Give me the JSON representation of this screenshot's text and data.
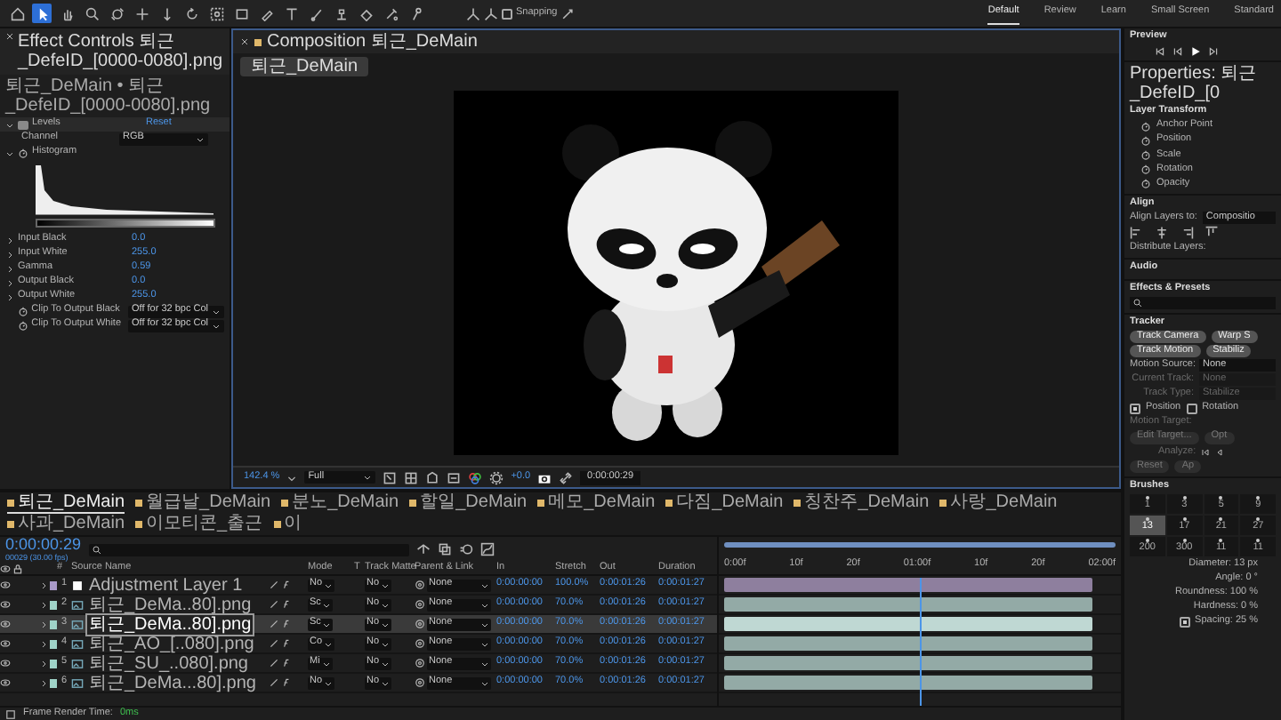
{
  "toolbar": {
    "tools": [
      {
        "kind": "home",
        "selected": false
      },
      {
        "kind": "selection",
        "selected": true
      },
      {
        "kind": "hand",
        "selected": false
      },
      {
        "kind": "zoom",
        "selected": false
      },
      {
        "kind": "orbit",
        "selected": false
      },
      {
        "kind": "pan",
        "selected": false
      },
      {
        "kind": "dolly",
        "selected": false
      },
      {
        "kind": "rotate",
        "selected": false
      },
      {
        "kind": "anchor",
        "selected": false
      },
      {
        "kind": "rectangle",
        "selected": false
      },
      {
        "kind": "pen",
        "selected": false
      },
      {
        "kind": "type",
        "selected": false
      },
      {
        "kind": "brush",
        "selected": false
      },
      {
        "kind": "stamp",
        "selected": false
      },
      {
        "kind": "eraser",
        "selected": false
      },
      {
        "kind": "roto",
        "selected": false
      },
      {
        "kind": "puppet",
        "selected": false
      }
    ],
    "snapping": {
      "label": "Snapping",
      "checked": false
    },
    "workspaces": [
      {
        "label": "Default",
        "selected": true
      },
      {
        "label": "Review",
        "selected": false
      },
      {
        "label": "Learn",
        "selected": false
      },
      {
        "label": "Small Screen",
        "selected": false
      },
      {
        "label": "Standard",
        "selected": false
      }
    ]
  },
  "effect_controls": {
    "tab": "Effect Controls 퇴근_DefeID_[0000-0080].png",
    "breadcrumb": "퇴근_DeMain • 퇴근_DefeID_[0000-0080].png",
    "effect": "Levels",
    "reset": "Reset",
    "channel_label": "Channel",
    "channel": "RGB",
    "histogram_label": "Histogram",
    "properties": [
      {
        "kind": "value",
        "label": "Input Black",
        "value": "0.0"
      },
      {
        "kind": "value",
        "label": "Input White",
        "value": "255.0"
      },
      {
        "kind": "value",
        "label": "Gamma",
        "value": "0.59"
      },
      {
        "kind": "value",
        "label": "Output Black",
        "value": "0.0"
      },
      {
        "kind": "value",
        "label": "Output White",
        "value": "255.0"
      },
      {
        "kind": "dropdown",
        "label": "Clip To Output Black",
        "value": "Off for 32 bpc Col"
      },
      {
        "kind": "dropdown",
        "label": "Clip To Output White",
        "value": "Off for 32 bpc Col"
      }
    ]
  },
  "composition": {
    "tab": "Composition 퇴근_DeMain",
    "chip": "퇴근_DeMain",
    "zoom": "142.4 %",
    "resolution": "Full",
    "exposure": "+0.0",
    "timecode": "0:00:00:29"
  },
  "right_panel": {
    "preview": "Preview",
    "properties_title": "Properties: 퇴근_DefeID_[0",
    "layer_transform": "Layer Transform",
    "transform_items": [
      "Anchor Point",
      "Position",
      "Scale",
      "Rotation",
      "Opacity"
    ],
    "align": "Align",
    "align_to_label": "Align Layers to:",
    "align_to": "Compositio",
    "distribute_label": "Distribute Layers:",
    "audio": "Audio",
    "effects_presets": "Effects & Presets",
    "tracker": {
      "title": "Tracker",
      "buttons": [
        {
          "label": "Track Camera",
          "disabled": false
        },
        {
          "label": "Warp S",
          "disabled": false
        },
        {
          "label": "Track Motion",
          "disabled": false
        },
        {
          "label": "Stabiliz",
          "disabled": false
        }
      ],
      "fields": [
        {
          "label": "Motion Source:",
          "value": "None",
          "disabled": false
        },
        {
          "label": "Current Track:",
          "value": "None",
          "disabled": true
        },
        {
          "label": "Track Type:",
          "value": "Stabilize",
          "disabled": true
        }
      ],
      "options": [
        {
          "label": "Position",
          "checked": true
        },
        {
          "label": "Rotation",
          "checked": false
        }
      ],
      "motion_target_label": "Motion Target:",
      "target_buttons": [
        {
          "label": "Edit Target...",
          "disabled": true
        },
        {
          "label": "Opt",
          "disabled": true
        }
      ],
      "analyze_label": "Analyze:",
      "action_buttons": [
        {
          "label": "Reset",
          "disabled": true
        },
        {
          "label": "Ap",
          "disabled": true
        }
      ]
    },
    "brushes": {
      "title": "Brushes",
      "sizes": [
        {
          "label": "1",
          "selected": false
        },
        {
          "label": "3",
          "selected": false
        },
        {
          "label": "5",
          "selected": false
        },
        {
          "label": "9",
          "selected": false
        },
        {
          "label": "13",
          "selected": true
        },
        {
          "label": "17",
          "selected": false
        },
        {
          "label": "21",
          "selected": false
        },
        {
          "label": "27",
          "selected": false
        },
        {
          "label": "200",
          "selected": false
        },
        {
          "label": "300",
          "selected": false
        },
        {
          "label": "11",
          "selected": false
        },
        {
          "label": "11",
          "selected": false
        }
      ],
      "settings": [
        "Diameter: 13 px",
        "Angle: 0 °",
        "Roundness: 100 %",
        "Hardness: 0 %"
      ],
      "spacing": {
        "label": "Spacing: 25 %",
        "checked": true
      }
    }
  },
  "timeline": {
    "tabs": [
      {
        "label": "퇴근_DeMain",
        "selected": true
      },
      {
        "label": "월급날_DeMain",
        "selected": false
      },
      {
        "label": "분노_DeMain",
        "selected": false
      },
      {
        "label": "할일_DeMain",
        "selected": false
      },
      {
        "label": "메모_DeMain",
        "selected": false
      },
      {
        "label": "다짐_DeMain",
        "selected": false
      },
      {
        "label": "칭찬주_DeMain",
        "selected": false
      },
      {
        "label": "사랑_DeMain",
        "selected": false
      },
      {
        "label": "사과_DeMain",
        "selected": false
      },
      {
        "label": "이모티콘_출근",
        "selected": false
      },
      {
        "label": "이",
        "selected": false
      }
    ],
    "timecode": "0:00:00:29",
    "fps": "00029 (30.00 fps)",
    "columns": [
      "#",
      "Source Name",
      "Mode",
      "T",
      "Track Matte",
      "Parent & Link",
      "In",
      "Stretch",
      "Out",
      "Duration"
    ],
    "ruler": [
      "0:00f",
      "10f",
      "20f",
      "01:00f",
      "10f",
      "20f",
      "02:00f"
    ],
    "playhead": {
      "level": 0.5
    },
    "layers": [
      {
        "number": "1",
        "name": "Adjustment Layer 1",
        "kind": "adjustment",
        "color": "#a99ac9",
        "selected": false,
        "mode": "No",
        "matte": "No",
        "parent": "None",
        "in": "0:00:00:00",
        "stretch": "100.0%",
        "out": "0:00:01:26",
        "duration": "0:00:01:27"
      },
      {
        "number": "2",
        "name": "퇴근_DeMa..80].png",
        "kind": "footage",
        "color": "#9fd3c8",
        "selected": false,
        "mode": "Sc",
        "matte": "No",
        "parent": "None",
        "in": "0:00:00:00",
        "stretch": "70.0%",
        "out": "0:00:01:26",
        "duration": "0:00:01:27"
      },
      {
        "number": "3",
        "name": "퇴근_DeMa..80].png",
        "kind": "footage",
        "color": "#9fd3c8",
        "selected": true,
        "mode": "Sc",
        "matte": "No",
        "parent": "None",
        "in": "0:00:00:00",
        "stretch": "70.0%",
        "out": "0:00:01:26",
        "duration": "0:00:01:27"
      },
      {
        "number": "4",
        "name": "퇴근_AO_[..080].png",
        "kind": "footage",
        "color": "#9fd3c8",
        "selected": false,
        "mode": "Co",
        "matte": "No",
        "parent": "None",
        "in": "0:00:00:00",
        "stretch": "70.0%",
        "out": "0:00:01:26",
        "duration": "0:00:01:27"
      },
      {
        "number": "5",
        "name": "퇴근_SU_..080].png",
        "kind": "footage",
        "color": "#9fd3c8",
        "selected": false,
        "mode": "Mi",
        "matte": "No",
        "parent": "None",
        "in": "0:00:00:00",
        "stretch": "70.0%",
        "out": "0:00:01:26",
        "duration": "0:00:01:27"
      },
      {
        "number": "6",
        "name": "퇴근_DeMa...80].png",
        "kind": "footage",
        "color": "#9fd3c8",
        "selected": false,
        "mode": "No",
        "matte": "No",
        "parent": "None",
        "in": "0:00:00:00",
        "stretch": "70.0%",
        "out": "0:00:01:26",
        "duration": "0:00:01:27"
      }
    ],
    "render_label": "Frame Render Time:",
    "render_time": "0ms"
  }
}
